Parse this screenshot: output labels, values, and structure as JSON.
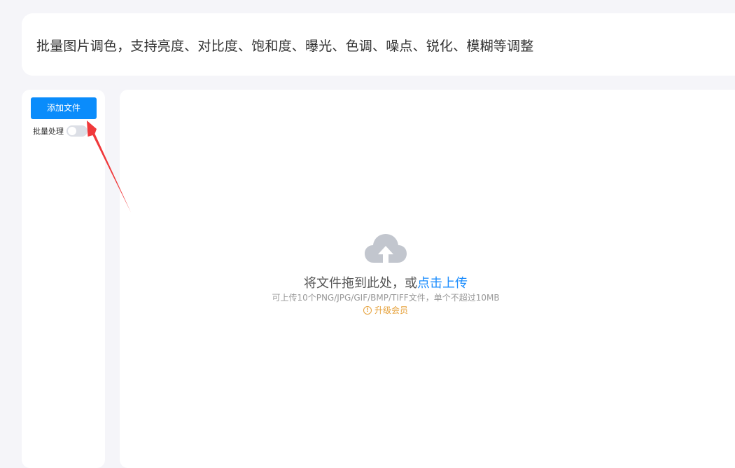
{
  "header": {
    "description": "批量图片调色，支持亮度、对比度、饱和度、曝光、色调、噪点、锐化、模糊等调整"
  },
  "sidebar": {
    "add_file_label": "添加文件",
    "batch_label": "批量处理",
    "batch_enabled": false
  },
  "dropzone": {
    "icon": "cloud-upload-icon",
    "prompt_prefix": "将文件拖到此处，或",
    "upload_link": "点击上传",
    "hint": "可上传10个PNG/JPG/GIF/BMP/TIFF文件，单个不超过10MB",
    "upgrade_icon": "warning-circle-icon",
    "upgrade_label": "升级会员"
  },
  "colors": {
    "primary": "#0a8cfb",
    "link": "#1a8cfe",
    "warning": "#e6a23c",
    "annotation_arrow": "#f0393b",
    "background": "#f5f5f9"
  }
}
